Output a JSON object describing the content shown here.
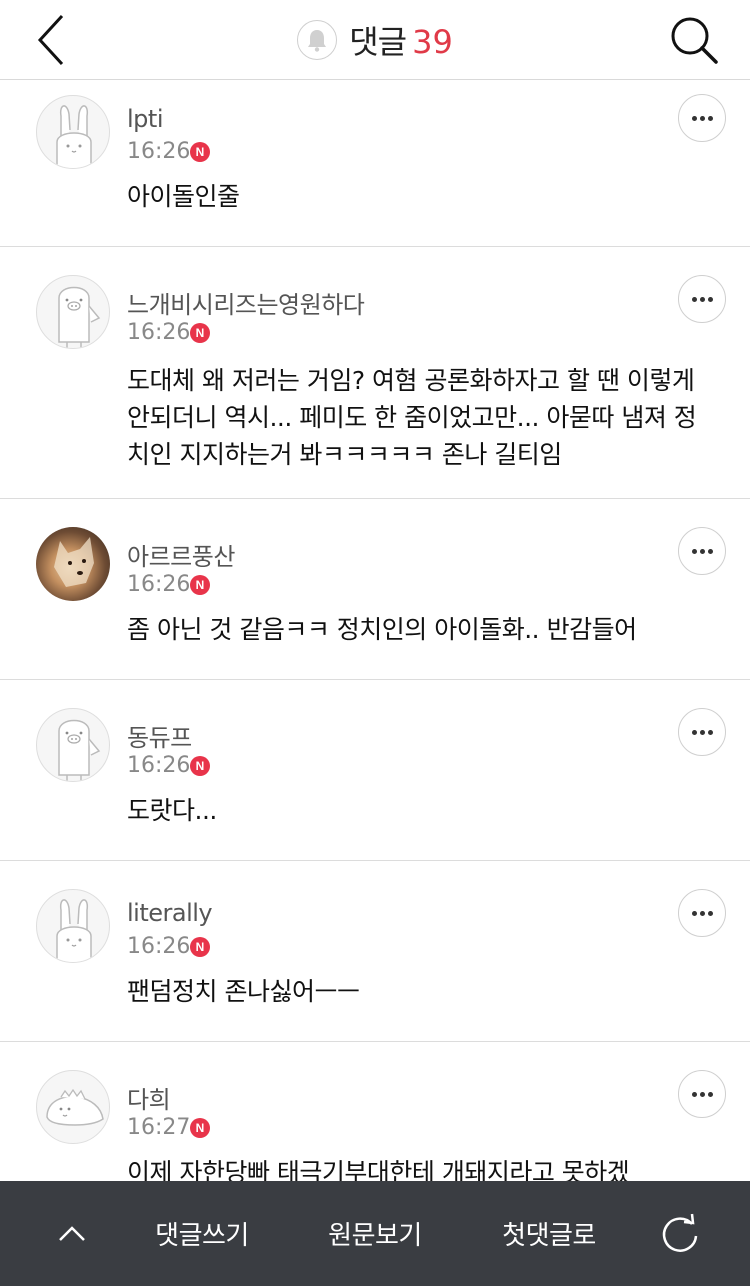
{
  "header": {
    "title": "댓글",
    "count": "39"
  },
  "comments": [
    {
      "author": "lpti",
      "time": "16:26",
      "badge": "N",
      "text": "아이돌인줄",
      "avatar": "rabbit"
    },
    {
      "author": "느개비시리즈는영원하다",
      "time": "16:26",
      "badge": "N",
      "text": "도대체 왜 저러는 거임? 여혐 공론화하자고 할 땐 이렇게 안되더니 역시... 페미도 한 줌이었고만... 아묻따 냄져 정치인 지지하는거 봐ㅋㅋㅋㅋㅋ 존나 길티임",
      "avatar": "pig"
    },
    {
      "author": "아르르풍산",
      "time": "16:26",
      "badge": "N",
      "text": "좀 아닌 것 같음ㅋㅋ 정치인의 아이돌화..  반감들어",
      "avatar": "dog-photo"
    },
    {
      "author": "동듀프",
      "time": "16:26",
      "badge": "N",
      "text": "도랏다...",
      "avatar": "pig"
    },
    {
      "author": "literally",
      "time": "16:26",
      "badge": "N",
      "text": "팬덤정치 존나싫어ㅡㅡ",
      "avatar": "rabbit"
    },
    {
      "author": "다희",
      "time": "16:27",
      "badge": "N",
      "text": "이제 자한당빠 태극기부대한테 개돼지라고 못하겠",
      "avatar": "dino"
    }
  ],
  "bottom_bar": {
    "write": "댓글쓰기",
    "original": "원문보기",
    "first": "첫댓글로"
  },
  "icons": {
    "back": "back-chevron-icon",
    "bell": "bell-icon",
    "search": "search-icon",
    "more": "more-dots-icon",
    "new": "new-badge-icon",
    "up": "chevron-up-icon",
    "refresh": "refresh-icon"
  },
  "colors": {
    "accent": "#e03a48",
    "badge": "#e8344a",
    "bottom_bar": "#3a3d42"
  }
}
